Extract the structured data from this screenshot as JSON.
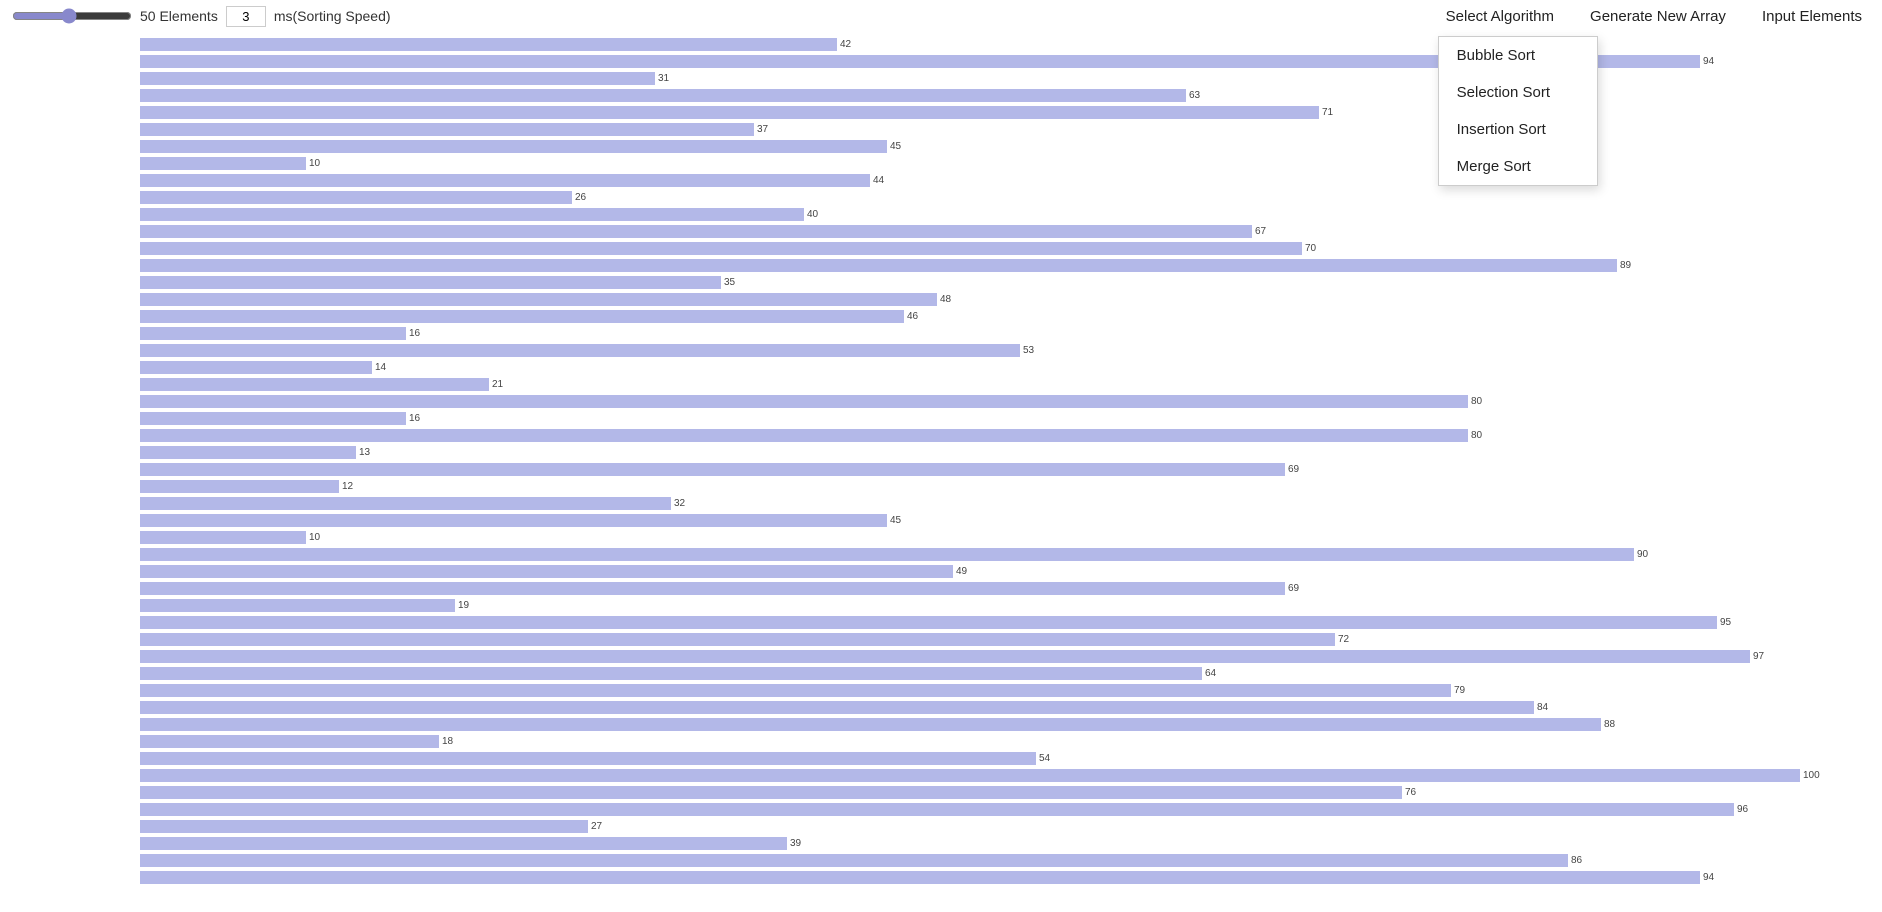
{
  "toolbar": {
    "elements_count": "50 Elements",
    "speed_value": "3",
    "speed_label": "ms(Sorting Speed)",
    "select_algo_label": "Select Algorithm",
    "generate_label": "Generate New Array",
    "input_label": "Input Elements"
  },
  "dropdown": {
    "items": [
      {
        "id": "bubble",
        "label": "Bubble Sort"
      },
      {
        "id": "selection",
        "label": "Selection Sort"
      },
      {
        "id": "insertion",
        "label": "Insertion Sort"
      },
      {
        "id": "merge",
        "label": "Merge Sort"
      }
    ]
  },
  "bars": [
    {
      "value": 42,
      "pct": 42
    },
    {
      "value": 94,
      "pct": 94
    },
    {
      "value": 31,
      "pct": 31
    },
    {
      "value": 63,
      "pct": 63
    },
    {
      "value": 71,
      "pct": 71
    },
    {
      "value": 37,
      "pct": 37
    },
    {
      "value": 45,
      "pct": 45
    },
    {
      "value": 10,
      "pct": 10
    },
    {
      "value": 44,
      "pct": 44
    },
    {
      "value": 26,
      "pct": 26
    },
    {
      "value": 40,
      "pct": 40
    },
    {
      "value": 67,
      "pct": 67
    },
    {
      "value": 70,
      "pct": 70
    },
    {
      "value": 89,
      "pct": 89
    },
    {
      "value": 35,
      "pct": 35
    },
    {
      "value": 48,
      "pct": 48
    },
    {
      "value": 46,
      "pct": 46
    },
    {
      "value": 16,
      "pct": 16
    },
    {
      "value": 53,
      "pct": 53
    },
    {
      "value": 14,
      "pct": 14
    },
    {
      "value": 21,
      "pct": 21
    },
    {
      "value": 80,
      "pct": 80
    },
    {
      "value": 16,
      "pct": 16
    },
    {
      "value": 80,
      "pct": 80
    },
    {
      "value": 13,
      "pct": 13
    },
    {
      "value": 69,
      "pct": 69
    },
    {
      "value": 12,
      "pct": 12
    },
    {
      "value": 32,
      "pct": 32
    },
    {
      "value": 45,
      "pct": 45
    },
    {
      "value": 10,
      "pct": 10
    },
    {
      "value": 90,
      "pct": 90
    },
    {
      "value": 49,
      "pct": 49
    },
    {
      "value": 69,
      "pct": 69
    },
    {
      "value": 19,
      "pct": 19
    },
    {
      "value": 95,
      "pct": 95
    },
    {
      "value": 72,
      "pct": 72
    },
    {
      "value": 97,
      "pct": 97
    },
    {
      "value": 64,
      "pct": 64
    },
    {
      "value": 79,
      "pct": 79
    },
    {
      "value": 84,
      "pct": 84
    },
    {
      "value": 88,
      "pct": 88
    },
    {
      "value": 18,
      "pct": 18
    },
    {
      "value": 54,
      "pct": 54
    },
    {
      "value": 100,
      "pct": 100
    },
    {
      "value": 76,
      "pct": 76
    },
    {
      "value": 96,
      "pct": 96
    },
    {
      "value": 27,
      "pct": 27
    },
    {
      "value": 39,
      "pct": 39
    },
    {
      "value": 86,
      "pct": 86
    },
    {
      "value": 94,
      "pct": 94
    }
  ]
}
